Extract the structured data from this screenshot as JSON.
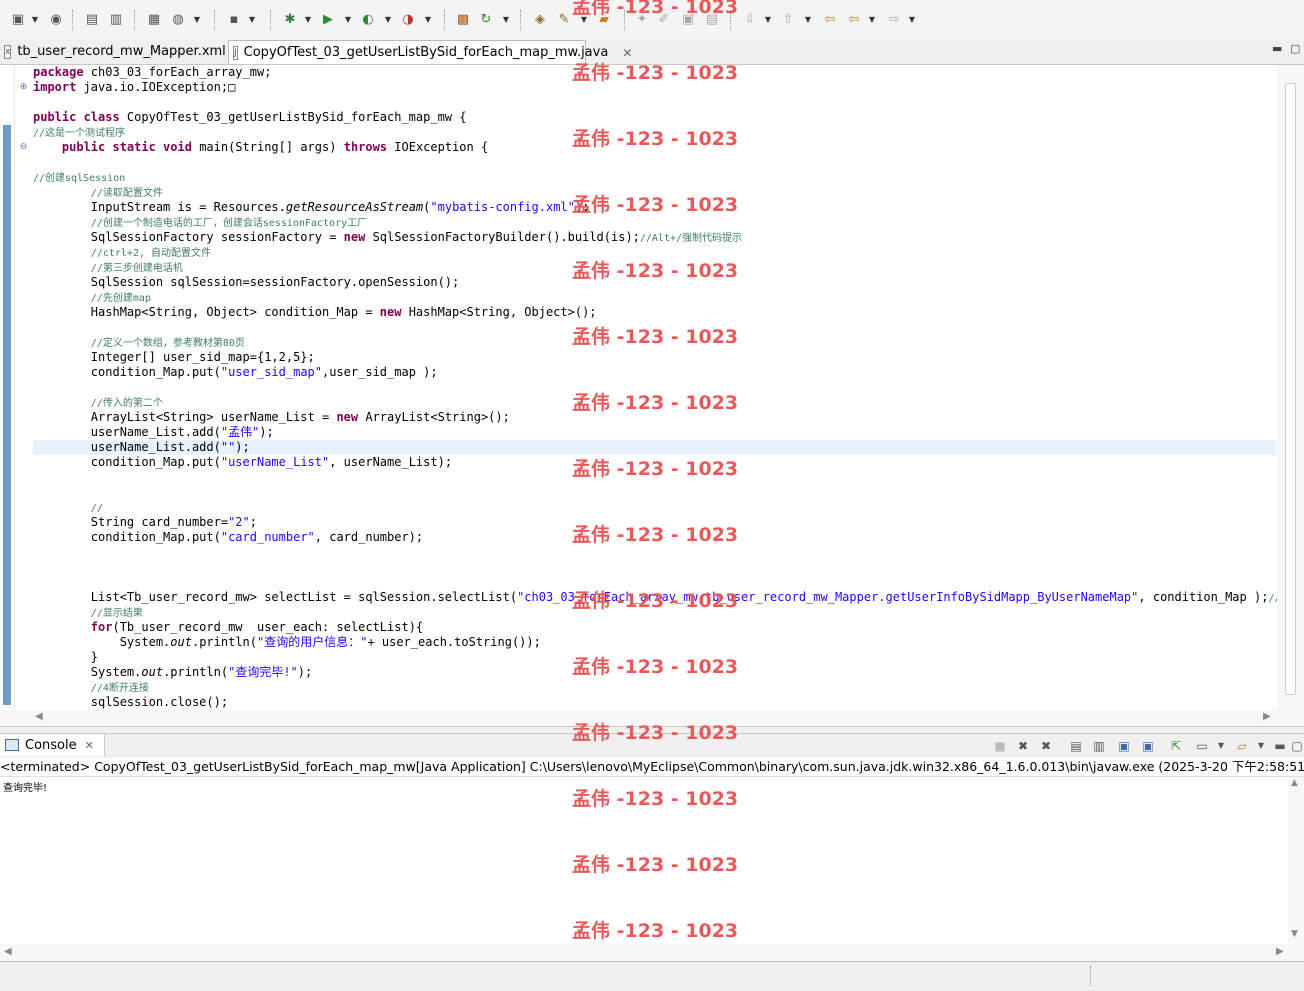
{
  "toolbar": {
    "icons": [
      "new-wizard",
      "globe",
      "open",
      "save-all",
      "new-class",
      "web-service",
      "debug-console",
      "debug",
      "run",
      "run-external",
      "external-tools",
      "server",
      "refresh",
      "open-type",
      "search",
      "open-folder",
      "annotation",
      "edit-pen",
      "task",
      "marker",
      "next-annotation",
      "prev-annotation",
      "back",
      "forward"
    ]
  },
  "editor": {
    "tabs": [
      {
        "label": "tb_user_record_mw_Mapper.xml",
        "active": false
      },
      {
        "label": "CopyOfTest_03_getUserListBySid_forEach_map_mw.java",
        "active": true
      }
    ]
  },
  "code": {
    "lines": [
      [
        {
          "t": "package ",
          "c": "kw"
        },
        {
          "t": "ch03_03_forEach_array_mw;"
        }
      ],
      [
        {
          "t": "import ",
          "c": "kw"
        },
        {
          "t": "java.io.IOException;"
        },
        {
          "t": "□"
        }
      ],
      [],
      [
        {
          "t": "public class ",
          "c": "kw"
        },
        {
          "t": "CopyOfTest_03_getUserListBySid_forEach_map_mw {"
        }
      ],
      [
        {
          "t": "//这是一个测试程序",
          "c": "cm"
        }
      ],
      [
        {
          "t": "    "
        },
        {
          "t": "public static void ",
          "c": "kw"
        },
        {
          "t": "main(String[] args) "
        },
        {
          "t": "throws ",
          "c": "kw"
        },
        {
          "t": "IOException {"
        }
      ],
      [],
      [
        {
          "t": "//创建sqlSession",
          "c": "cm"
        }
      ],
      [
        {
          "t": "        "
        },
        {
          "t": "//读取配置文件",
          "c": "cm"
        }
      ],
      [
        {
          "t": "        InputStream is = Resources."
        },
        {
          "t": "getResourceAsStream",
          "c": "it"
        },
        {
          "t": "("
        },
        {
          "t": "\"mybatis-config.xml\"",
          "c": "str"
        },
        {
          "t": ");"
        }
      ],
      [
        {
          "t": "        "
        },
        {
          "t": "//创建一个制造电话的工厂，创建会话sessionFactory工厂",
          "c": "cm"
        }
      ],
      [
        {
          "t": "        SqlSessionFactory sessionFactory = "
        },
        {
          "t": "new ",
          "c": "kw"
        },
        {
          "t": "SqlSessionFactoryBuilder().build(is);"
        },
        {
          "t": "//Alt+/强制代码提示",
          "c": "cm"
        }
      ],
      [
        {
          "t": "        "
        },
        {
          "t": "//ctrl+2, 自动配置文件",
          "c": "cm"
        }
      ],
      [
        {
          "t": "        "
        },
        {
          "t": "//第三步创建电话机",
          "c": "cm"
        }
      ],
      [
        {
          "t": "        SqlSession sqlSession=sessionFactory.openSession();"
        }
      ],
      [
        {
          "t": "        "
        },
        {
          "t": "//先创建map",
          "c": "cm"
        }
      ],
      [
        {
          "t": "        HashMap<String, Object> condition_Map = "
        },
        {
          "t": "new ",
          "c": "kw"
        },
        {
          "t": "HashMap<String, Object>();"
        }
      ],
      [],
      [
        {
          "t": "        "
        },
        {
          "t": "//定义一个数组，参考教材第80页",
          "c": "cm"
        }
      ],
      [
        {
          "t": "        Integer[] user_sid_map={1,2,5};"
        }
      ],
      [
        {
          "t": "        condition_Map.put("
        },
        {
          "t": "\"user_sid_map\"",
          "c": "str"
        },
        {
          "t": ",user_sid_map );"
        }
      ],
      [],
      [
        {
          "t": "        "
        },
        {
          "t": "//传入的第二个",
          "c": "cm"
        }
      ],
      [
        {
          "t": "        ArrayList<String> userName_List = "
        },
        {
          "t": "new ",
          "c": "kw"
        },
        {
          "t": "ArrayList<String>();"
        }
      ],
      [
        {
          "t": "        userName_List.add("
        },
        {
          "t": "\"孟伟\"",
          "c": "str"
        },
        {
          "t": ");"
        }
      ],
      [
        {
          "t": "        userName_List.add("
        },
        {
          "t": "\"\"",
          "c": "str"
        },
        {
          "t": ");"
        }
      ],
      [
        {
          "t": "        condition_Map.put("
        },
        {
          "t": "\"userName_List\"",
          "c": "str"
        },
        {
          "t": ", userName_List);"
        }
      ],
      [],
      [],
      [
        {
          "t": "        "
        },
        {
          "t": "//",
          "c": "cm"
        }
      ],
      [
        {
          "t": "        String card_number="
        },
        {
          "t": "\"2\"",
          "c": "str"
        },
        {
          "t": ";"
        }
      ],
      [
        {
          "t": "        condition_Map.put("
        },
        {
          "t": "\"card_number\"",
          "c": "str"
        },
        {
          "t": ", card_number);"
        }
      ],
      [],
      [],
      [],
      [
        {
          "t": "        List<Tb_user_record_mw> selectList = sqlSession.selectList("
        },
        {
          "t": "\"ch03_03_forEach_array_mw.tb_user_record_mw_Mapper.getUserInfoBySidMapp_ByUserNameMap\"",
          "c": "str"
        },
        {
          "t": ", condition_Map );"
        },
        {
          "t": "//",
          "c": "cm"
        }
      ],
      [
        {
          "t": "        "
        },
        {
          "t": "//显示结果",
          "c": "cm"
        }
      ],
      [
        {
          "t": "        "
        },
        {
          "t": "for",
          "c": "kw"
        },
        {
          "t": "(Tb_user_record_mw  user_each: selectList){"
        }
      ],
      [
        {
          "t": "            System."
        },
        {
          "t": "out",
          "c": "it"
        },
        {
          "t": ".println("
        },
        {
          "t": "\"查询的用户信息：\"",
          "c": "str"
        },
        {
          "t": "+ user_each.toString());"
        }
      ],
      [
        {
          "t": "        }"
        }
      ],
      [
        {
          "t": "        System."
        },
        {
          "t": "out",
          "c": "it"
        },
        {
          "t": ".println("
        },
        {
          "t": "\"查询完毕!\"",
          "c": "str"
        },
        {
          "t": ");"
        }
      ],
      [
        {
          "t": "        "
        },
        {
          "t": "//4断开连接",
          "c": "cm"
        }
      ],
      [
        {
          "t": "        sqlSession.close();"
        }
      ]
    ],
    "highlight_line": 25
  },
  "console": {
    "tab_label": "Console",
    "status": "<terminated> CopyOfTest_03_getUserListBySid_forEach_map_mw[Java Application] C:\\Users\\lenovo\\MyEclipse\\Common\\binary\\com.sun.java.jdk.win32.x86_64_1.6.0.013\\bin\\javaw.exe (2025-3-20 下午2:58:51)",
    "output": "查询完毕!"
  },
  "watermark": {
    "text": "孟伟 -123 - 1023",
    "color": "#e85a5a"
  }
}
